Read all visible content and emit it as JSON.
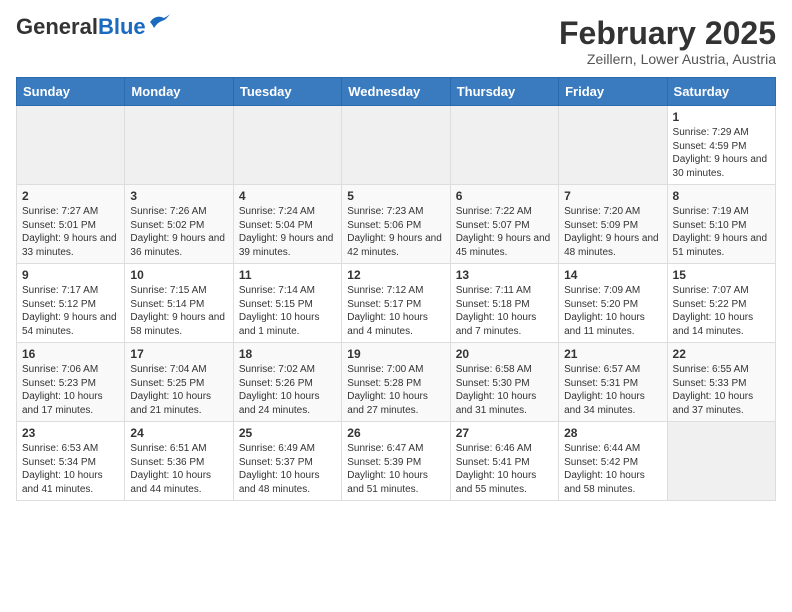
{
  "header": {
    "logo_general": "General",
    "logo_blue": "Blue",
    "month_title": "February 2025",
    "location": "Zeillern, Lower Austria, Austria"
  },
  "weekdays": [
    "Sunday",
    "Monday",
    "Tuesday",
    "Wednesday",
    "Thursday",
    "Friday",
    "Saturday"
  ],
  "weeks": [
    [
      {
        "day": "",
        "info": ""
      },
      {
        "day": "",
        "info": ""
      },
      {
        "day": "",
        "info": ""
      },
      {
        "day": "",
        "info": ""
      },
      {
        "day": "",
        "info": ""
      },
      {
        "day": "",
        "info": ""
      },
      {
        "day": "1",
        "info": "Sunrise: 7:29 AM\nSunset: 4:59 PM\nDaylight: 9 hours and 30 minutes."
      }
    ],
    [
      {
        "day": "2",
        "info": "Sunrise: 7:27 AM\nSunset: 5:01 PM\nDaylight: 9 hours and 33 minutes."
      },
      {
        "day": "3",
        "info": "Sunrise: 7:26 AM\nSunset: 5:02 PM\nDaylight: 9 hours and 36 minutes."
      },
      {
        "day": "4",
        "info": "Sunrise: 7:24 AM\nSunset: 5:04 PM\nDaylight: 9 hours and 39 minutes."
      },
      {
        "day": "5",
        "info": "Sunrise: 7:23 AM\nSunset: 5:06 PM\nDaylight: 9 hours and 42 minutes."
      },
      {
        "day": "6",
        "info": "Sunrise: 7:22 AM\nSunset: 5:07 PM\nDaylight: 9 hours and 45 minutes."
      },
      {
        "day": "7",
        "info": "Sunrise: 7:20 AM\nSunset: 5:09 PM\nDaylight: 9 hours and 48 minutes."
      },
      {
        "day": "8",
        "info": "Sunrise: 7:19 AM\nSunset: 5:10 PM\nDaylight: 9 hours and 51 minutes."
      }
    ],
    [
      {
        "day": "9",
        "info": "Sunrise: 7:17 AM\nSunset: 5:12 PM\nDaylight: 9 hours and 54 minutes."
      },
      {
        "day": "10",
        "info": "Sunrise: 7:15 AM\nSunset: 5:14 PM\nDaylight: 9 hours and 58 minutes."
      },
      {
        "day": "11",
        "info": "Sunrise: 7:14 AM\nSunset: 5:15 PM\nDaylight: 10 hours and 1 minute."
      },
      {
        "day": "12",
        "info": "Sunrise: 7:12 AM\nSunset: 5:17 PM\nDaylight: 10 hours and 4 minutes."
      },
      {
        "day": "13",
        "info": "Sunrise: 7:11 AM\nSunset: 5:18 PM\nDaylight: 10 hours and 7 minutes."
      },
      {
        "day": "14",
        "info": "Sunrise: 7:09 AM\nSunset: 5:20 PM\nDaylight: 10 hours and 11 minutes."
      },
      {
        "day": "15",
        "info": "Sunrise: 7:07 AM\nSunset: 5:22 PM\nDaylight: 10 hours and 14 minutes."
      }
    ],
    [
      {
        "day": "16",
        "info": "Sunrise: 7:06 AM\nSunset: 5:23 PM\nDaylight: 10 hours and 17 minutes."
      },
      {
        "day": "17",
        "info": "Sunrise: 7:04 AM\nSunset: 5:25 PM\nDaylight: 10 hours and 21 minutes."
      },
      {
        "day": "18",
        "info": "Sunrise: 7:02 AM\nSunset: 5:26 PM\nDaylight: 10 hours and 24 minutes."
      },
      {
        "day": "19",
        "info": "Sunrise: 7:00 AM\nSunset: 5:28 PM\nDaylight: 10 hours and 27 minutes."
      },
      {
        "day": "20",
        "info": "Sunrise: 6:58 AM\nSunset: 5:30 PM\nDaylight: 10 hours and 31 minutes."
      },
      {
        "day": "21",
        "info": "Sunrise: 6:57 AM\nSunset: 5:31 PM\nDaylight: 10 hours and 34 minutes."
      },
      {
        "day": "22",
        "info": "Sunrise: 6:55 AM\nSunset: 5:33 PM\nDaylight: 10 hours and 37 minutes."
      }
    ],
    [
      {
        "day": "23",
        "info": "Sunrise: 6:53 AM\nSunset: 5:34 PM\nDaylight: 10 hours and 41 minutes."
      },
      {
        "day": "24",
        "info": "Sunrise: 6:51 AM\nSunset: 5:36 PM\nDaylight: 10 hours and 44 minutes."
      },
      {
        "day": "25",
        "info": "Sunrise: 6:49 AM\nSunset: 5:37 PM\nDaylight: 10 hours and 48 minutes."
      },
      {
        "day": "26",
        "info": "Sunrise: 6:47 AM\nSunset: 5:39 PM\nDaylight: 10 hours and 51 minutes."
      },
      {
        "day": "27",
        "info": "Sunrise: 6:46 AM\nSunset: 5:41 PM\nDaylight: 10 hours and 55 minutes."
      },
      {
        "day": "28",
        "info": "Sunrise: 6:44 AM\nSunset: 5:42 PM\nDaylight: 10 hours and 58 minutes."
      },
      {
        "day": "",
        "info": ""
      }
    ]
  ]
}
